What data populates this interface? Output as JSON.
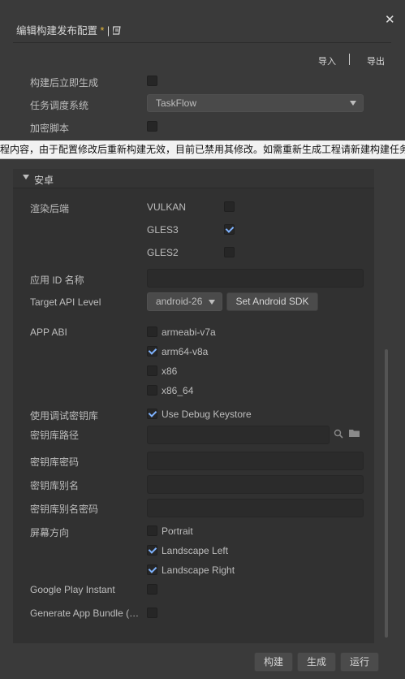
{
  "dialog": {
    "title": "编辑构建发布配置",
    "modified_marker": "*",
    "title_sep": "|",
    "book_icon": "book-icon",
    "close_glyph": "✕"
  },
  "toolbar": {
    "import": "导入",
    "export": "导出"
  },
  "general": {
    "build_immediately": "构建后立即生成",
    "task_scheduler_label": "任务调度系统",
    "task_scheduler_value": "TaskFlow",
    "encrypt_script": "加密脚本"
  },
  "tooltip": "程内容，由于配置修改后重新构建无效，目前已禁用其修改。如需重新生成工程请新建构建任务",
  "android": {
    "section_title": "安卓",
    "render_backend_label": "渲染后端",
    "backends": [
      {
        "name": "VULKAN",
        "checked": false
      },
      {
        "name": "GLES3",
        "checked": true
      },
      {
        "name": "GLES2",
        "checked": false
      }
    ],
    "app_id_label": "应用 ID 名称",
    "app_id_value": "",
    "target_api_label": "Target API Level",
    "target_api_value": "android-26",
    "set_sdk_button": "Set Android SDK",
    "abi_label": "APP ABI",
    "abis": [
      {
        "name": "armeabi-v7a",
        "checked": false
      },
      {
        "name": "arm64-v8a",
        "checked": true
      },
      {
        "name": "x86",
        "checked": false
      },
      {
        "name": "x86_64",
        "checked": false
      }
    ],
    "debug_keystore_label": "使用调试密钥库",
    "debug_keystore_option": "Use Debug Keystore",
    "debug_keystore_checked": true,
    "keystore_path_label": "密钥库路径",
    "keystore_password_label": "密钥库密码",
    "keystore_alias_label": "密钥库别名",
    "keystore_alias_password_label": "密钥库别名密码",
    "orientation_label": "屏幕方向",
    "orientations": [
      {
        "name": "Portrait",
        "checked": false
      },
      {
        "name": "Landscape Left",
        "checked": true
      },
      {
        "name": "Landscape Right",
        "checked": true
      }
    ],
    "google_play_instant_label": "Google Play Instant",
    "google_play_instant_checked": false,
    "app_bundle_label": "Generate App Bundle (…",
    "app_bundle_checked": false
  },
  "footer": {
    "build": "构建",
    "generate": "生成",
    "run": "运行"
  },
  "colors": {
    "background": "#3a3a3a",
    "panel": "#313131",
    "check": "#7fb3ff",
    "modified": "#e6b93a"
  }
}
